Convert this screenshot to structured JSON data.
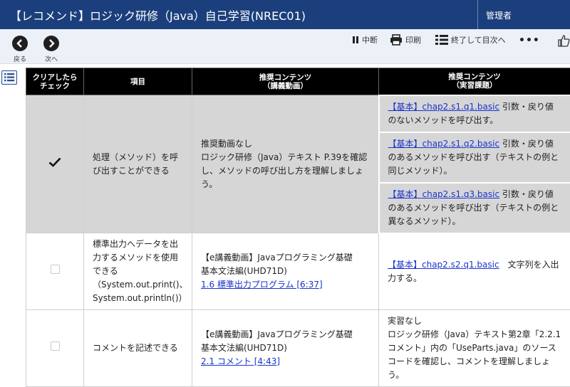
{
  "header": {
    "title": "【レコメンド】ロジック研修（Java）自己学習(NREC01)",
    "user": "管理者"
  },
  "toolbar": {
    "back_label": "戻る",
    "next_label": "次へ",
    "pause_label": "中断",
    "print_label": "印刷",
    "finish_label": "終了して目次へ",
    "more_label": "•••"
  },
  "table": {
    "headers": {
      "check": [
        "クリアしたら",
        "チェック"
      ],
      "item": "項目",
      "lecture": [
        "推奨コンテンツ",
        "（講義動画）"
      ],
      "practice": [
        "推奨コンテンツ",
        "（実習課題）"
      ]
    },
    "rows": [
      {
        "checked": true,
        "item": "処理（メソッド）を呼び出すことができる",
        "lecture": [
          "推奨動画なし",
          "ロジック研修（Java）テキスト P.39を確認し、メソッドの呼び出し方を理解しましょう。"
        ],
        "practices": [
          {
            "link": "【基本】chap2.s1.q1.basic",
            "text": " 引数・戻り値のないメソッドを呼び出す。"
          },
          {
            "link": "【基本】chap2.s1.q2.basic",
            "text": " 引数・戻り値のあるメソッドを呼び出す（テキストの例と同じメソッド）。"
          },
          {
            "link": "【基本】chap2.s1.q3.basic",
            "text": " 引数・戻り値のあるメソッドを呼び出す（テキストの例と異なるメソッド）。"
          }
        ]
      },
      {
        "checked": false,
        "item": [
          "標準出力へデータを出力するメソッドを使用できる",
          "（System.out.print()、System.out.println()）"
        ],
        "lecture": {
          "lines": [
            "【e講義動画】Javaプログラミング基礎",
            "基本文法編(UHD71D)"
          ],
          "link": "1.6 標準出力プログラム [6:37]"
        },
        "practice": {
          "link": "【基本】chap2.s2.q1.basic",
          "text": "　文字列を入出力する。"
        }
      },
      {
        "checked": false,
        "item": "コメントを記述できる",
        "lecture": {
          "lines": [
            "【e講義動画】Javaプログラミング基礎",
            "基本文法編(UHD71D)"
          ],
          "link": "2.1 コメント [4:43]"
        },
        "practice": {
          "lines": [
            "実習なし",
            "ロジック研修（Java）テキスト第2章「2.2.1 コメント」内の「UseParts.java」のソースコードを確認し、コメントを理解しましょう。"
          ]
        }
      }
    ]
  }
}
